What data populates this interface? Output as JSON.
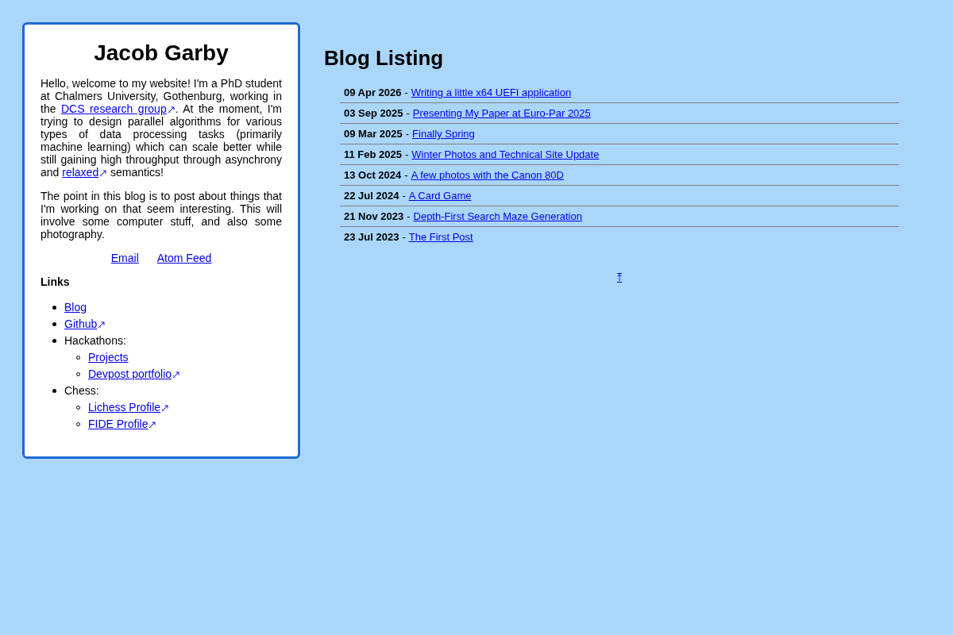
{
  "sidebar": {
    "title": "Jacob Garby",
    "intro": [
      {
        "text": "Hello, welcome to my website! I'm a PhD student at Chalmers University, Gothenburg, working in the "
      },
      {
        "link": "DCS research group",
        "external": true
      },
      {
        "text": ". At the moment, I'm trying to design parallel algorithms for various types of data processing tasks (primarily machine learning) which can scale better while still gaining high throughput through asynchrony and "
      },
      {
        "link": "relaxed",
        "external": true
      },
      {
        "text": " semantics!"
      }
    ],
    "about": "The point in this blog is to post about things that I'm working on that seem interesting. This will involve some computer stuff, and also some photography.",
    "contact_links": [
      "Email",
      "Atom Feed"
    ],
    "links_heading": "Links",
    "links": [
      {
        "label": "Blog",
        "kind": "link",
        "external": false
      },
      {
        "label": "Github",
        "kind": "link",
        "external": true
      },
      {
        "label": "Hackathons:",
        "kind": "group",
        "children": [
          {
            "label": "Projects",
            "kind": "link",
            "external": false
          },
          {
            "label": "Devpost portfolio",
            "kind": "link",
            "external": true
          }
        ]
      },
      {
        "label": "Chess:",
        "kind": "group",
        "children": [
          {
            "label": "Lichess Profile",
            "kind": "link",
            "external": true
          },
          {
            "label": "FIDE Profile",
            "kind": "link",
            "external": true
          }
        ]
      }
    ]
  },
  "main": {
    "title": "Blog Listing",
    "posts": [
      {
        "date": "09 Apr 2026",
        "separator": "-",
        "title": "Writing a little x64 UEFI application"
      },
      {
        "date": "03 Sep 2025",
        "separator": "-",
        "title": "Presenting My Paper at Euro-Par 2025"
      },
      {
        "date": "09 Mar 2025",
        "separator": "-",
        "title": "Finally Spring"
      },
      {
        "date": "11 Feb 2025",
        "separator": "-",
        "title": "Winter Photos and Technical Site Update"
      },
      {
        "date": "13 Oct 2024",
        "separator": "-",
        "title": "A few photos with the Canon 80D"
      },
      {
        "date": "22 Jul 2024",
        "separator": "-",
        "title": "A Card Game"
      },
      {
        "date": "21 Nov 2023",
        "separator": "-",
        "title": "Depth-First Search Maze Generation"
      },
      {
        "date": "23 Jul 2023",
        "separator": "-",
        "title": "The First Post"
      }
    ],
    "top_link": "⤒"
  }
}
